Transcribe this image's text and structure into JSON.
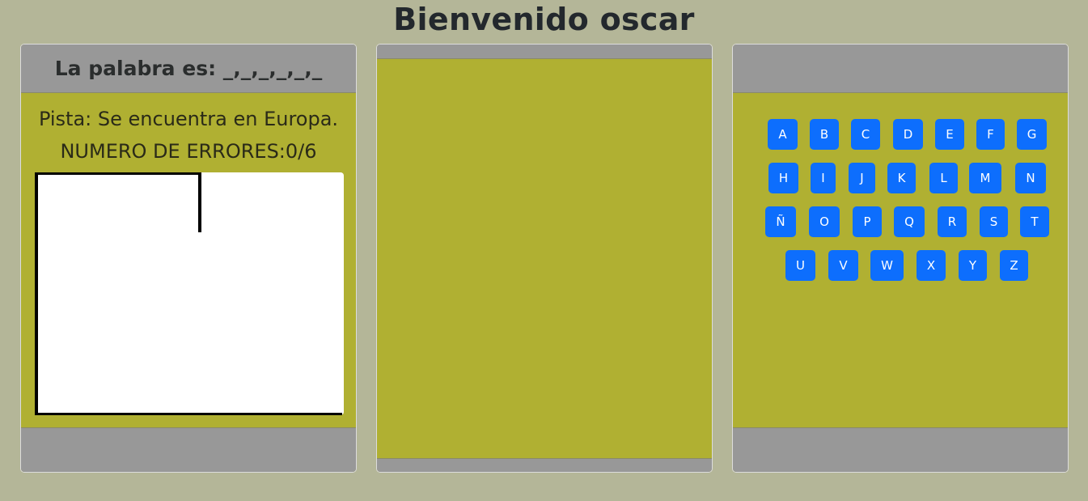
{
  "page": {
    "title": "Bienvenido oscar"
  },
  "word_panel": {
    "word_label": "La palabra es: _,_,_,_,_,_",
    "hint": "Pista: Se encuentra en Europa.",
    "errors_label": "NUMERO DE ERRORES:",
    "errors_count": "0/6"
  },
  "keyboard": {
    "rows": [
      [
        "A",
        "B",
        "C",
        "D",
        "E",
        "F",
        "G"
      ],
      [
        "H",
        "I",
        "J",
        "K",
        "L",
        "M",
        "N"
      ],
      [
        "Ñ",
        "O",
        "P",
        "Q",
        "R",
        "S",
        "T"
      ],
      [
        "U",
        "V",
        "W",
        "X",
        "Y",
        "Z"
      ]
    ]
  },
  "colors": {
    "background": "#b4b698",
    "card_body": "#b0b032",
    "card_header": "#989898",
    "key_button": "#0d6efd"
  }
}
